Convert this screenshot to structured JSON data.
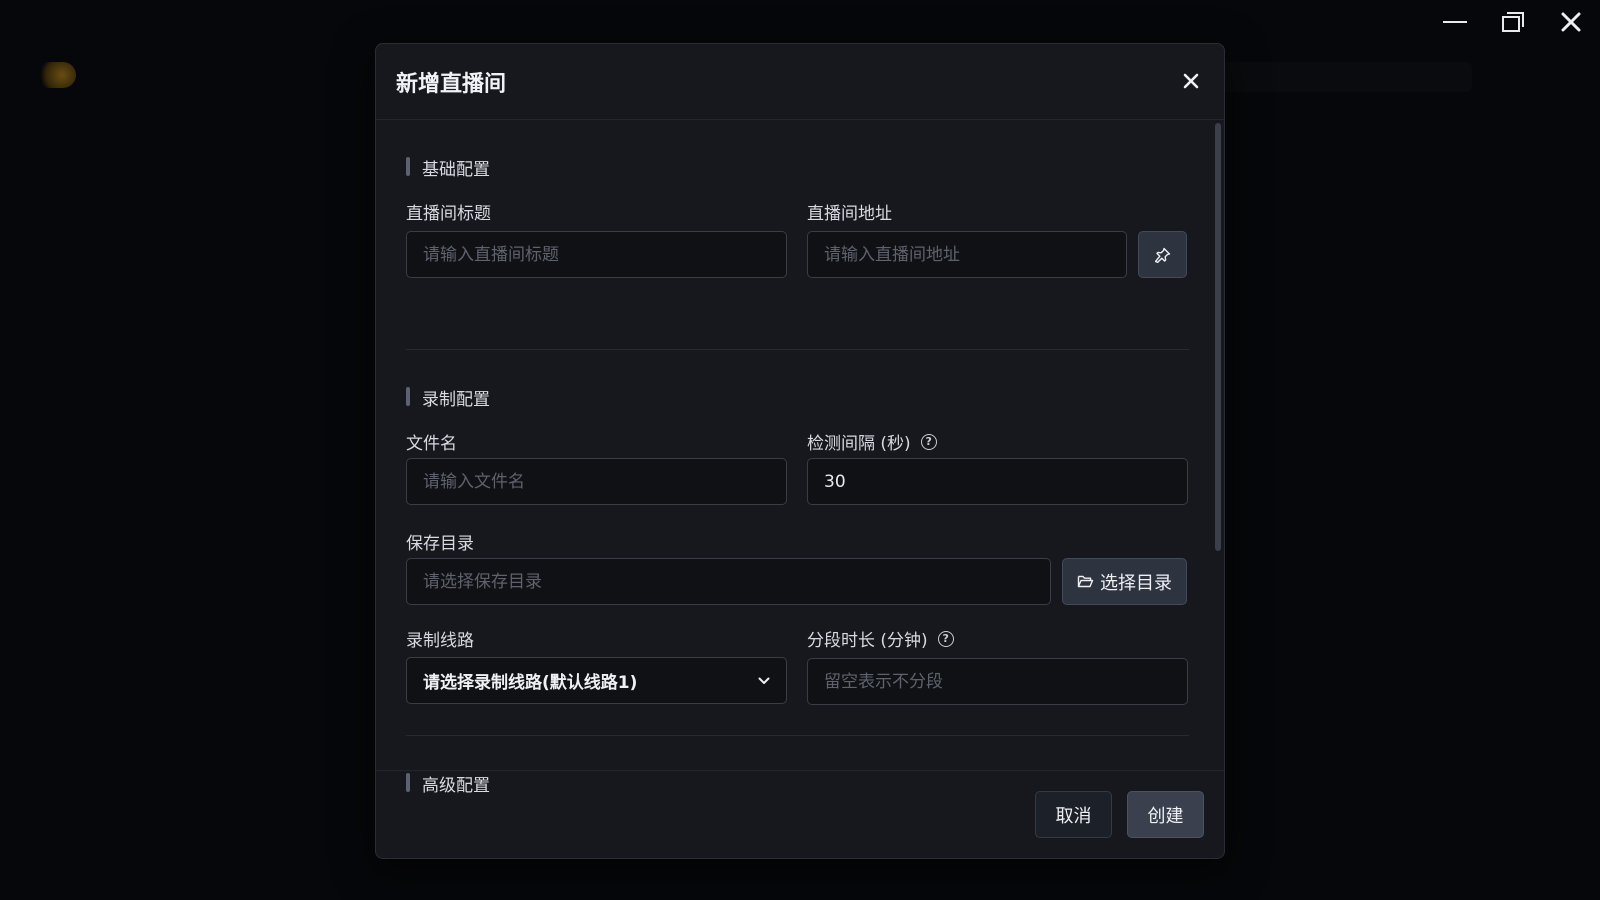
{
  "window": {
    "controls": [
      "minimize",
      "maximize",
      "close"
    ]
  },
  "dialog": {
    "title": "新增直播间",
    "close_icon": "close-icon",
    "sections": {
      "basic": "基础配置",
      "record": "录制配置",
      "advanced": "高级配置"
    },
    "fields": {
      "room_title": {
        "label": "直播间标题",
        "placeholder": "请输入直播间标题",
        "value": ""
      },
      "room_url": {
        "label": "直播间地址",
        "placeholder": "请输入直播间地址",
        "value": "",
        "action_icon": "pin-icon"
      },
      "filename": {
        "label": "文件名",
        "placeholder": "请输入文件名",
        "value": ""
      },
      "interval": {
        "label": "检测间隔 (秒)",
        "value": "30",
        "help_icon": "question-circle-icon"
      },
      "save_dir": {
        "label": "保存目录",
        "placeholder": "请选择保存目录",
        "value": "",
        "button_label": "选择目录",
        "button_icon": "folder-icon"
      },
      "route": {
        "label": "录制线路",
        "selected": "请选择录制线路(默认线路1)",
        "icon": "chevron-down-icon"
      },
      "segment": {
        "label": "分段时长 (分钟)",
        "placeholder": "留空表示不分段",
        "value": "",
        "help_icon": "question-circle-icon"
      }
    },
    "footer": {
      "cancel_label": "取消",
      "create_label": "创建"
    }
  },
  "colors": {
    "modal_bg": "#17181d",
    "input_bg": "#101115",
    "input_border": "#3a3d46",
    "button_bg": "#2e3340",
    "text": "#e6e8ee",
    "placeholder": "#5e626d"
  }
}
